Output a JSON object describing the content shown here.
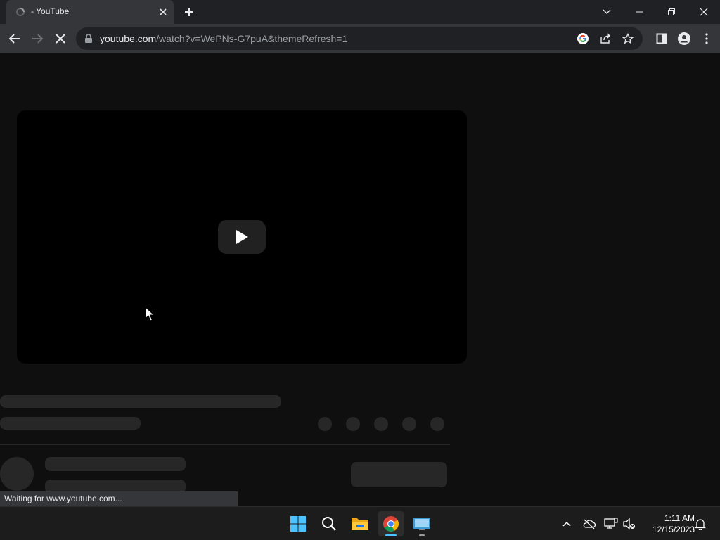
{
  "browser": {
    "tab": {
      "title": "- YouTube"
    },
    "omnibox": {
      "domain": "youtube.com",
      "path": "/watch?v=WePNs-G7puA&themeRefresh=1"
    },
    "status_text": "Waiting for www.youtube.com..."
  },
  "taskbar": {
    "apps": [
      {
        "name": "Start",
        "icon": "windows-start-icon"
      },
      {
        "name": "Search",
        "icon": "search-icon"
      },
      {
        "name": "File Explorer",
        "icon": "folder-icon"
      },
      {
        "name": "Google Chrome",
        "icon": "chrome-icon"
      },
      {
        "name": "Remote Desktop",
        "icon": "remote-desktop-icon"
      }
    ],
    "clock": {
      "time": "1:11 AM",
      "date": "12/15/2023"
    }
  },
  "colors": {
    "page_bg": "#0f0f0f",
    "skeleton": "#272727",
    "chrome_frame": "#202124",
    "chrome_toolbar": "#35363a",
    "taskbar_accent": "#4cc2ff"
  }
}
